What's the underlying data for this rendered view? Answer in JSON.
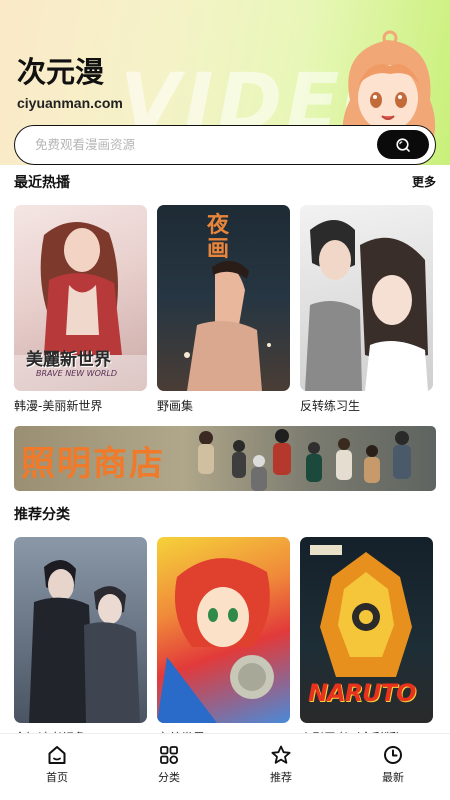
{
  "header": {
    "title": "次元漫",
    "domain": "ciyuanman.com",
    "watermark": "VIDEO"
  },
  "search": {
    "placeholder": "免费观看漫画资源",
    "icon": "search-icon"
  },
  "recent": {
    "title": "最近热播",
    "more_label": "更多",
    "items": [
      {
        "title": "韩漫-美丽新世界",
        "cover_text": "美麗新世界",
        "cover_subtext": "BRAVE NEW WORLD"
      },
      {
        "title": "野画集",
        "cover_text": "夜画"
      },
      {
        "title": "反转练习生"
      }
    ]
  },
  "banner": {
    "text": "照明商店"
  },
  "categories": {
    "title": "推荐分类",
    "items": [
      {
        "title": "全知读者视角"
      },
      {
        "title": "完美世界"
      },
      {
        "title": "火影忍者（全彩版）",
        "cover_text": "NARUTO"
      }
    ]
  },
  "tabbar": {
    "items": [
      {
        "label": "首页",
        "icon": "home-icon"
      },
      {
        "label": "分类",
        "icon": "category-grid-icon"
      },
      {
        "label": "推荐",
        "icon": "star-icon"
      },
      {
        "label": "最新",
        "icon": "clock-icon"
      }
    ]
  },
  "colors": {
    "accent": "#0b0b0b",
    "banner_text": "#f07a2a"
  }
}
